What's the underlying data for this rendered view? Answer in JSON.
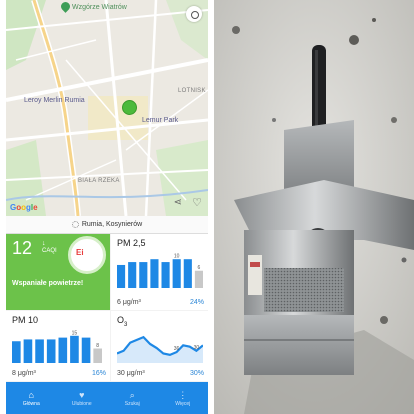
{
  "map": {
    "top_park": "Wzgórze Wiatrów",
    "poi_leroy": "Leroy Merlin Rumia",
    "poi_lemur": "Lemur Park",
    "district_lotnisko": "LOTNISK",
    "district_biala_rzeka": "BIAŁA RZEKA",
    "google": [
      "G",
      "o",
      "o",
      "g",
      "l",
      "e"
    ]
  },
  "location": {
    "name": "Rumia, Kosynierów"
  },
  "aqi": {
    "value": "12",
    "arrow": "↓",
    "unit": "CAQI",
    "status": "Wspaniałe powietrze!",
    "logo": "Ei",
    "color": "#6cc24a"
  },
  "pm25": {
    "title": "PM 2,5",
    "value": "6 μg/m³",
    "percent": "24%",
    "bars": [
      8,
      9,
      9,
      10,
      9,
      10,
      10,
      6
    ],
    "bar_labels": {
      "5": "10",
      "7": "6"
    }
  },
  "pm10": {
    "title": "PM 10",
    "value": "8 μg/m³",
    "percent": "16%",
    "bars": [
      12,
      13,
      13,
      13,
      14,
      15,
      14,
      8
    ],
    "bar_labels": {
      "5": "15",
      "7": "8"
    }
  },
  "o3": {
    "title": "O",
    "title_sub": "3",
    "value": "30 μg/m³",
    "percent": "30%",
    "line": [
      24,
      26,
      32,
      34,
      36,
      31,
      28,
      24,
      23,
      25,
      30,
      29,
      26,
      30
    ],
    "point_labels": {
      "9": "36",
      "12": "30"
    }
  },
  "nav": [
    {
      "label": "Główna",
      "icon": "home-icon",
      "glyph": "⌂",
      "active": true
    },
    {
      "label": "Ulubione",
      "icon": "heart-icon",
      "glyph": "♥",
      "active": false
    },
    {
      "label": "Szukaj",
      "icon": "search-icon",
      "glyph": "⌕",
      "active": false
    },
    {
      "label": "Więcej",
      "icon": "more-icon",
      "glyph": "⋮",
      "active": false
    }
  ],
  "colors": {
    "accent": "#1e88e5",
    "bar": "#1e88e5",
    "bar_last": "#c8c8c8",
    "good": "#6cc24a"
  }
}
